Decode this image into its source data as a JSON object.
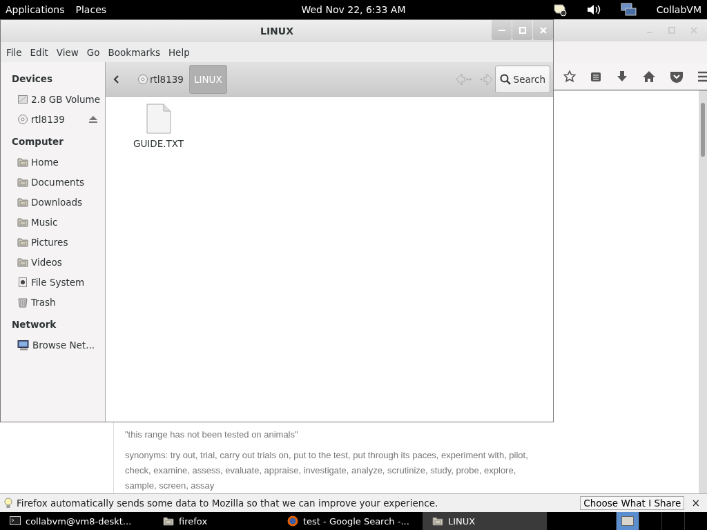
{
  "top_panel": {
    "menus": [
      "Applications",
      "Places"
    ],
    "clock": "Wed Nov 22,  6:33 AM",
    "user": "CollabVM"
  },
  "browser": {
    "quote": "\"this range has not been tested on animals\"",
    "synonyms": "synonyms: try out, trial, carry out trials on, put to the test, put through its paces, experiment with, pilot, check, examine, assess, evaluate, appraise, investigate, analyze, scrutinize, study, probe, explore, sample, screen, assay",
    "notification": {
      "message": "Firefox automatically sends some data to Mozilla so that we can improve your experience.",
      "button": "Choose What I Share",
      "close": "×"
    }
  },
  "file_manager": {
    "title": "LINUX",
    "menu": [
      "File",
      "Edit",
      "View",
      "Go",
      "Bookmarks",
      "Help"
    ],
    "sidebar": [
      {
        "heading": "Devices",
        "items": [
          {
            "label": "2.8 GB Volume",
            "kind": "drive",
            "eject": false
          },
          {
            "label": "rtl8139",
            "kind": "disc",
            "eject": true
          }
        ]
      },
      {
        "heading": "Computer",
        "items": [
          {
            "label": "Home",
            "kind": "folder",
            "eject": false
          },
          {
            "label": "Documents",
            "kind": "folder",
            "eject": false
          },
          {
            "label": "Downloads",
            "kind": "folder",
            "eject": false
          },
          {
            "label": "Music",
            "kind": "folder",
            "eject": false
          },
          {
            "label": "Pictures",
            "kind": "folder",
            "eject": false
          },
          {
            "label": "Videos",
            "kind": "folder",
            "eject": false
          },
          {
            "label": "File System",
            "kind": "filesystem",
            "eject": false
          },
          {
            "label": "Trash",
            "kind": "trash",
            "eject": false
          }
        ]
      },
      {
        "heading": "Network",
        "items": [
          {
            "label": "Browse Net...",
            "kind": "network",
            "eject": false
          }
        ]
      }
    ],
    "path": [
      {
        "label": "rtl8139",
        "selected": false
      },
      {
        "label": "LINUX",
        "selected": true
      }
    ],
    "search_button": "Search",
    "files": [
      {
        "name": "GUIDE.TXT"
      }
    ]
  },
  "taskbar": [
    {
      "label": "collabvm@vm8-deskt...",
      "kind": "terminal",
      "selected": false
    },
    {
      "label": "firefox",
      "kind": "folder",
      "selected": false
    },
    {
      "label": "test - Google Search -...",
      "kind": "globe",
      "selected": false
    },
    {
      "label": "LINUX",
      "kind": "folder",
      "selected": true
    }
  ]
}
